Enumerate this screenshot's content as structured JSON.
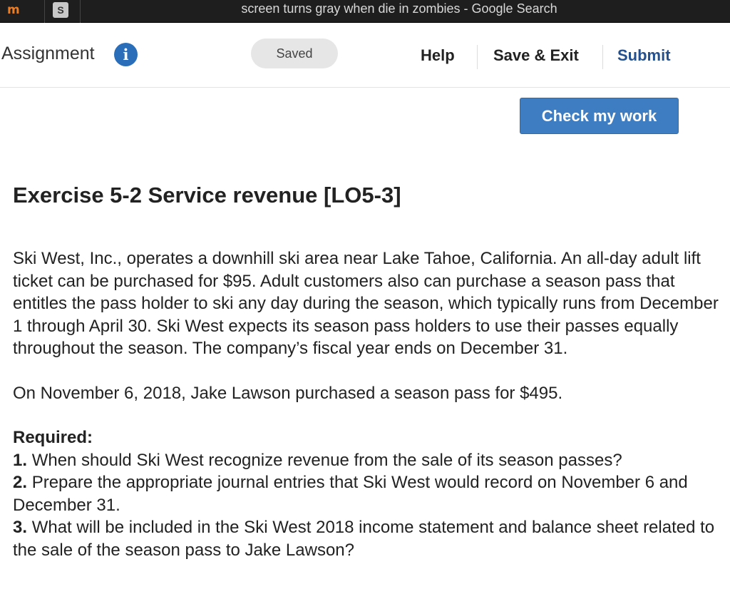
{
  "browser": {
    "tab1_icon": "mcgraw-hill-m-icon",
    "tab1_glyph": "m",
    "tab2_icon": "s-favicon",
    "tab2_glyph": "S",
    "tab_title": "screen turns gray when die in zombies - Google Search"
  },
  "header": {
    "assignment_label": "Assignment",
    "info_glyph": "i",
    "saved_status": "Saved",
    "help_label": "Help",
    "save_exit_label": "Save & Exit",
    "submit_label": "Submit"
  },
  "check_button_label": "Check my work",
  "exercise": {
    "title": "Exercise 5-2 Service revenue [LO5-3]",
    "paragraph1": "Ski West, Inc., operates a downhill ski area near Lake Tahoe, California. An all-day adult lift ticket can be purchased for $95. Adult customers also can purchase a season pass that entitles the pass holder to ski any day during the season, which typically runs from December 1 through April 30. Ski West expects its season pass holders to use their passes equally throughout the season. The company’s fiscal year ends on December 31.",
    "paragraph2": "On November 6, 2018, Jake Lawson purchased a season pass for $495.",
    "required_heading": "Required:",
    "requirements": [
      {
        "num": "1.",
        "text": "When should Ski West recognize revenue from the sale of its season passes?"
      },
      {
        "num": "2.",
        "text": "Prepare the appropriate journal entries that Ski West would record on November 6 and December 31."
      },
      {
        "num": "3.",
        "text": "What will be included in the Ski West 2018 income statement and balance sheet related to the sale of the season pass to Jake Lawson?"
      }
    ]
  },
  "colors": {
    "accent_blue": "#3e7dc1",
    "submit_blue": "#24508f",
    "info_blue": "#2a6db8"
  }
}
